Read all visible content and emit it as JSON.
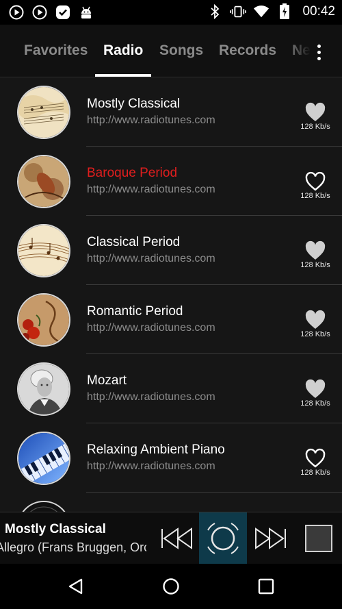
{
  "status_bar": {
    "time": "00:42",
    "left_icons": [
      "play-circle-icon",
      "play-circle-icon",
      "check-badge-icon",
      "android-icon"
    ],
    "right_icons": [
      "bluetooth-icon",
      "vibrate-icon",
      "wifi-icon",
      "battery-charging-icon"
    ]
  },
  "tabs": [
    {
      "label": "Favorites",
      "active": false
    },
    {
      "label": "Radio",
      "active": true
    },
    {
      "label": "Songs",
      "active": false
    },
    {
      "label": "Records",
      "active": false
    },
    {
      "label": "Ne",
      "active": false
    }
  ],
  "stations": [
    {
      "title": "Mostly Classical",
      "url": "http://www.radiotunes.com",
      "rate": "128 Kb/s",
      "favorite": true,
      "playing": false,
      "thumb": "sheet-music-icon"
    },
    {
      "title": "Baroque Period",
      "url": "http://www.radiotunes.com",
      "rate": "128 Kb/s",
      "favorite": false,
      "playing": true,
      "thumb": "baroque-art-icon"
    },
    {
      "title": "Classical Period",
      "url": "http://www.radiotunes.com",
      "rate": "128 Kb/s",
      "favorite": true,
      "playing": false,
      "thumb": "music-notes-icon"
    },
    {
      "title": "Romantic Period",
      "url": "http://www.radiotunes.com",
      "rate": "128 Kb/s",
      "favorite": true,
      "playing": false,
      "thumb": "roses-clef-icon"
    },
    {
      "title": "Mozart",
      "url": "http://www.radiotunes.com",
      "rate": "128 Kb/s",
      "favorite": true,
      "playing": false,
      "thumb": "mozart-portrait-icon"
    },
    {
      "title": "Relaxing Ambient Piano",
      "url": "http://www.radiotunes.com",
      "rate": "128 Kb/s",
      "favorite": false,
      "playing": false,
      "thumb": "piano-keys-icon"
    }
  ],
  "player": {
    "title": "Mostly Classical",
    "subtitle": "Allegro (Frans Bruggen, Orchestra"
  },
  "colors": {
    "background": "#161616",
    "playing_title": "#e01e1e",
    "play_button_bg": "#0e3a4a",
    "heart_filled": "#cfcfcf"
  }
}
